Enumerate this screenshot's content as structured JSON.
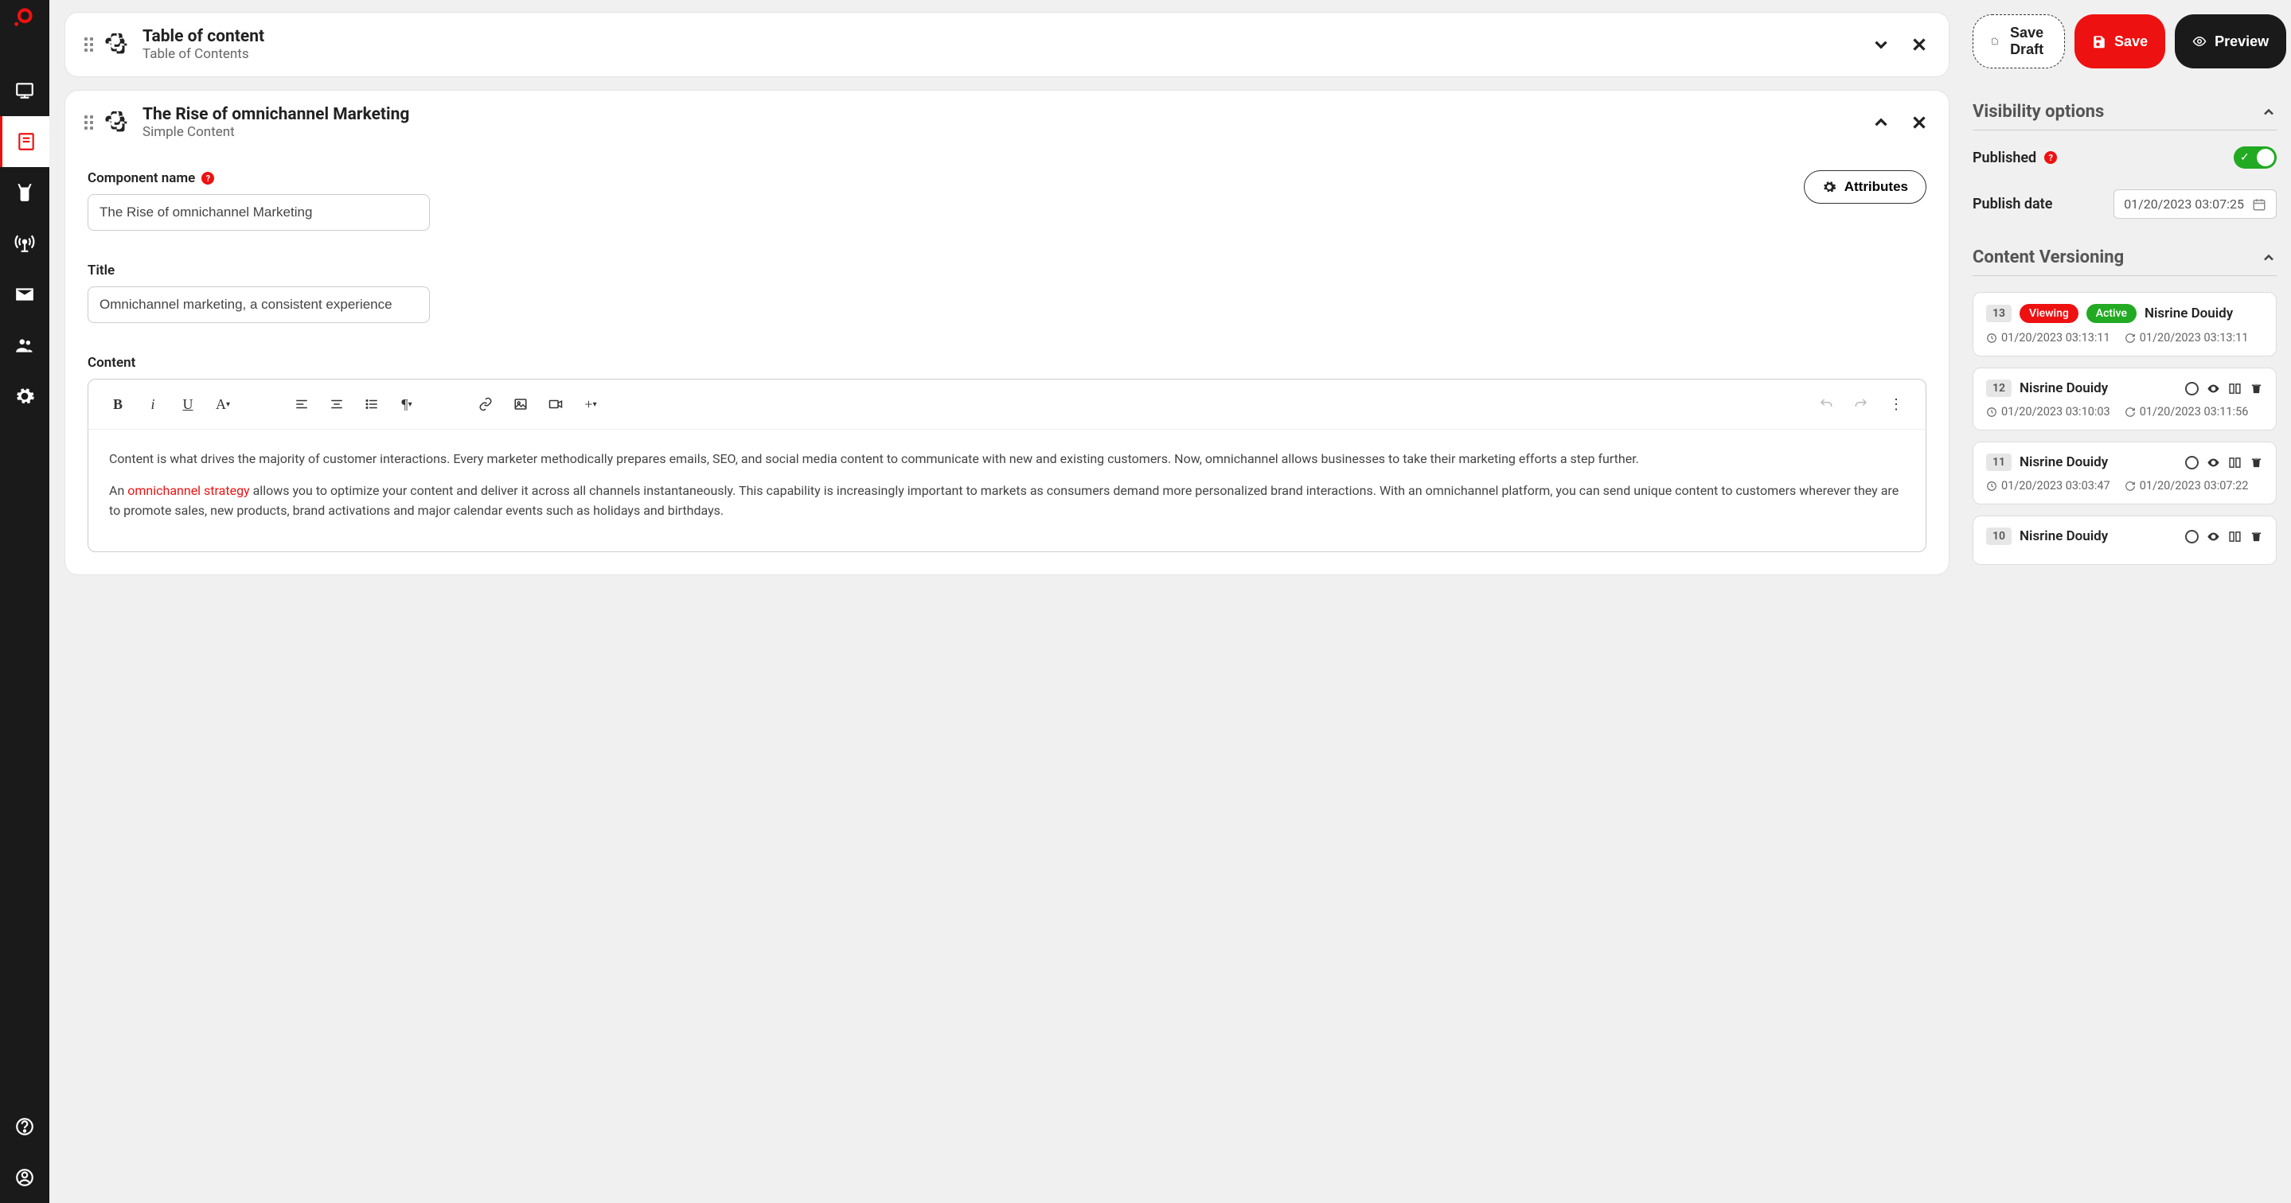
{
  "actions": {
    "save_draft": "Save Draft",
    "save": "Save",
    "preview": "Preview"
  },
  "blocks": {
    "toc": {
      "title": "Table of content",
      "subtitle": "Table of Contents"
    },
    "rise": {
      "title": "The Rise of omnichannel Marketing",
      "subtitle": "Simple Content"
    }
  },
  "form": {
    "component_name_label": "Component name",
    "component_name_value": "The Rise of omnichannel Marketing",
    "attributes_btn": "Attributes",
    "title_label": "Title",
    "title_value": "Omnichannel marketing, a consistent experience",
    "content_label": "Content",
    "para1": "Content is what drives the majority of customer interactions. Every marketer methodically prepares emails, SEO, and social media content to communicate with new and existing customers. Now, omnichannel allows businesses to take their marketing efforts a step further.",
    "para2_pre": "An ",
    "para2_link": "omnichannel strategy",
    "para2_post": " allows you to optimize your content and deliver it across all channels instantaneously. This capability is increasingly important to markets as consumers demand more personalized brand interactions. With an omnichannel platform, you can send unique content to customers wherever they are to promote sales, new products, brand activations and major calendar events such as holidays and birthdays."
  },
  "visibility": {
    "heading": "Visibility options",
    "published_label": "Published",
    "publish_date_label": "Publish date",
    "publish_date_value": "01/20/2023 03:07:25"
  },
  "versioning": {
    "heading": "Content Versioning",
    "items": [
      {
        "num": "13",
        "viewing": "Viewing",
        "active": "Active",
        "user": "Nisrine Douidy",
        "created": "01/20/2023 03:13:11",
        "updated": "01/20/2023 03:13:11",
        "current": true
      },
      {
        "num": "12",
        "user": "Nisrine Douidy",
        "created": "01/20/2023 03:10:03",
        "updated": "01/20/2023 03:11:56"
      },
      {
        "num": "11",
        "user": "Nisrine Douidy",
        "created": "01/20/2023 03:03:47",
        "updated": "01/20/2023 03:07:22"
      },
      {
        "num": "10",
        "user": "Nisrine Douidy"
      }
    ]
  }
}
